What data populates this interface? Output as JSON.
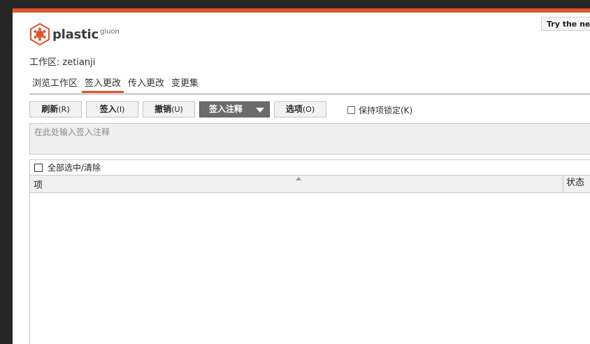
{
  "app": {
    "brand": "plastic",
    "brand_sub": "gluon",
    "accent_color": "#e2532b",
    "try_new_label": "Try the new"
  },
  "workspace": {
    "label": "工作区:",
    "name": "zetianji"
  },
  "tabs": [
    {
      "label": "浏览工作区",
      "active": false
    },
    {
      "label": "签入更改",
      "active": true
    },
    {
      "label": "传入更改",
      "active": false
    },
    {
      "label": "变更集",
      "active": false
    }
  ],
  "toolbar": {
    "refresh": {
      "label": "刷新",
      "key": "(R)"
    },
    "checkin": {
      "label": "签入",
      "key": "(I)"
    },
    "undo": {
      "label": "撤销",
      "key": "(U)"
    },
    "checkin_comment": {
      "label": "签入注释"
    },
    "options": {
      "label": "选项",
      "key": "(O)"
    },
    "keep_locked": {
      "label": "保持项锁定(K)",
      "checked": false
    }
  },
  "comment": {
    "placeholder": "在此处输入签入注释"
  },
  "select_all": {
    "label": "全部选中/清除",
    "checked": false
  },
  "grid": {
    "columns": [
      "项",
      "状态"
    ],
    "rows": []
  }
}
